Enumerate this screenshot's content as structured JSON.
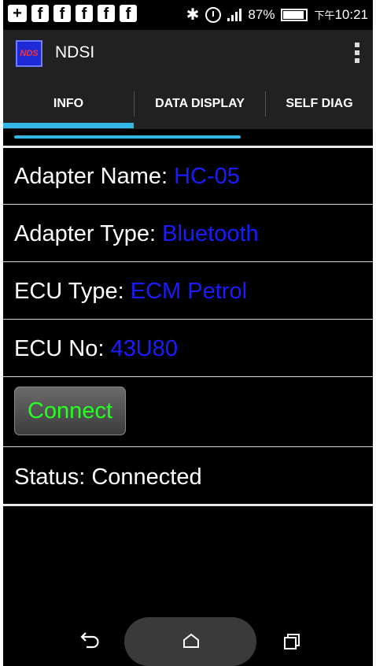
{
  "status_bar": {
    "notification_icons": [
      "plus-box-icon",
      "facebook-icon",
      "facebook-icon",
      "facebook-icon",
      "facebook-icon",
      "facebook-icon"
    ],
    "fb_glyph": "f",
    "plus_glyph": "+",
    "battery": "87%",
    "time_prefix": "下午",
    "time": "10:21"
  },
  "app": {
    "logo_text": "NDS",
    "title": "NDSI"
  },
  "tabs": [
    {
      "label": "INFO",
      "selected": true
    },
    {
      "label": "DATA DISPLAY",
      "selected": false
    },
    {
      "label": "SELF DIAG",
      "selected": false
    }
  ],
  "info": {
    "adapter_name_label": "Adapter Name:",
    "adapter_name_value": "HC-05",
    "adapter_type_label": "Adapter Type:",
    "adapter_type_value": "Bluetooth",
    "ecu_type_label": "ECU Type:",
    "ecu_type_value": "ECM Petrol",
    "ecu_no_label": "ECU No:",
    "ecu_no_value": "43U80",
    "connect_label": "Connect",
    "status_label": "Status:",
    "status_value": "Connected"
  },
  "colors": {
    "value_text": "#1b1bff",
    "connect_text": "#26ff1f",
    "tab_indicator": "#33b5e5"
  }
}
